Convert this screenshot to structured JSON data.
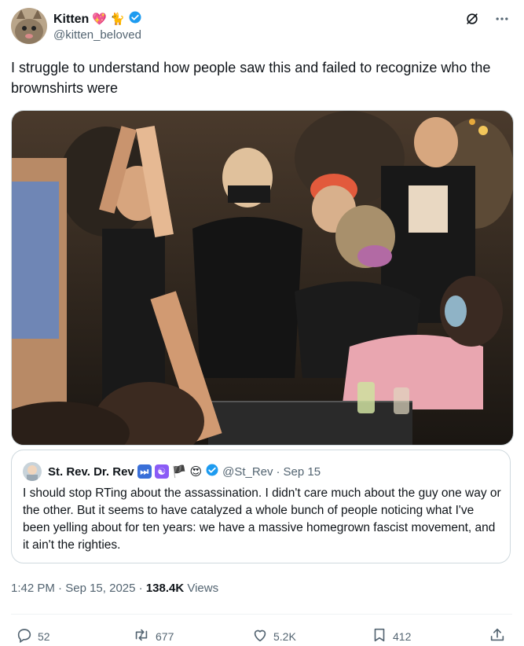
{
  "author": {
    "display_name": "Kitten",
    "handle": "@kitten_beloved",
    "emojis": [
      "💖",
      "🐈"
    ],
    "verified": true
  },
  "tweet_text": "I struggle to understand how people saw this and failed to recognize who the brownshirts were",
  "quote": {
    "display_name": "St. Rev. Dr. Rev",
    "handle": "@St_Rev",
    "separator": "·",
    "date": "Sep 15",
    "emojis": [
      "⏭",
      "☯",
      "🏴",
      "😍"
    ],
    "verified": true,
    "text": "I should stop RTing about the assassination. I didn't care much about the guy one way or the other. But it seems to have catalyzed a whole bunch of people noticing what I've been yelling about for ten years: we have a massive homegrown fascist movement, and it ain't the righties."
  },
  "meta": {
    "time": "1:42 PM",
    "dot": "·",
    "date": "Sep 15, 2025",
    "views_count": "138.4K",
    "views_label": "Views"
  },
  "actions": {
    "replies": "52",
    "reposts": "677",
    "likes": "5.2K",
    "bookmarks": "412"
  },
  "colors": {
    "verified": "#1d9bf0",
    "secondary_text": "#536471",
    "border": "#cfd9de"
  },
  "icons": [
    "grok-icon",
    "more-icon",
    "reply-icon",
    "repost-icon",
    "like-icon",
    "bookmark-icon",
    "share-icon",
    "verified-badge-icon"
  ]
}
